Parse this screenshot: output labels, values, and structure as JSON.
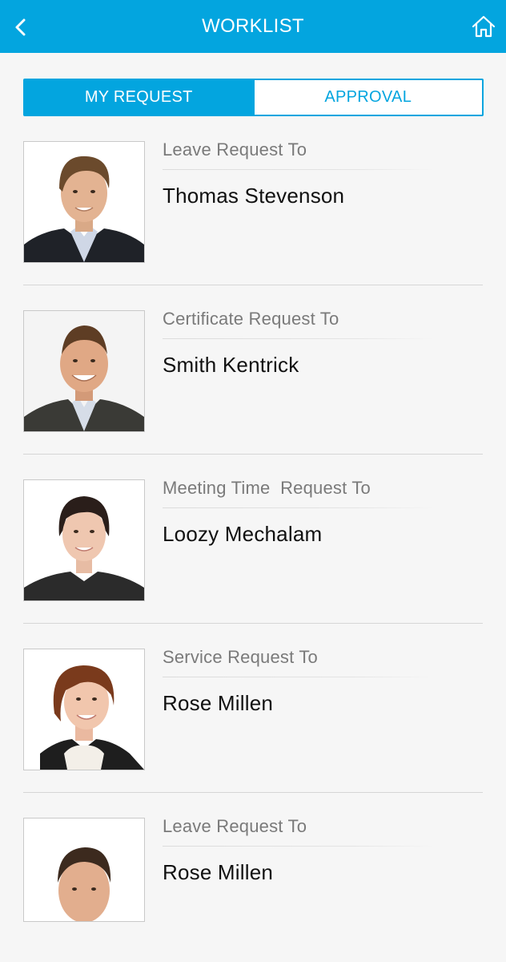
{
  "header": {
    "title": "WORKLIST",
    "back_icon": "chevron-left-icon",
    "home_icon": "home-icon",
    "color": "#03a5df"
  },
  "tabs": [
    {
      "label": "MY REQUEST",
      "active": true
    },
    {
      "label": "APPROVAL",
      "active": false
    }
  ],
  "requests": [
    {
      "type": "Leave Request To",
      "name": "Thomas Stevenson"
    },
    {
      "type": "Certificate Request To",
      "name": "Smith Kentrick"
    },
    {
      "type": "Meeting Time  Request To",
      "name": "Loozy Mechalam"
    },
    {
      "type": "Service Request To",
      "name": "Rose Millen"
    },
    {
      "type": "Leave Request To",
      "name": "Rose Millen"
    }
  ]
}
